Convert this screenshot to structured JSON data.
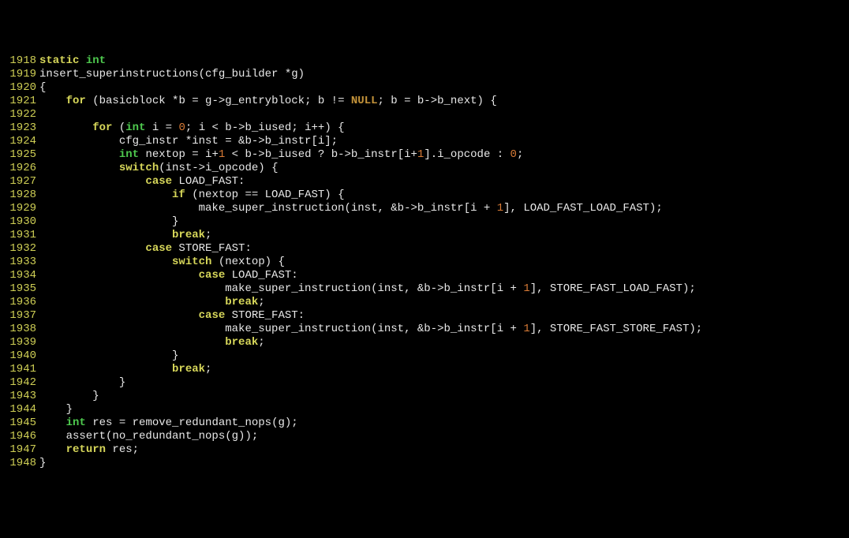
{
  "lines": [
    {
      "n": "1918",
      "segs": [
        {
          "t": "static",
          "c": "kw"
        },
        {
          "t": " "
        },
        {
          "t": "int",
          "c": "type"
        }
      ]
    },
    {
      "n": "1919",
      "segs": [
        {
          "t": "insert_superinstructions(cfg_builder *g)"
        }
      ]
    },
    {
      "n": "1920",
      "segs": [
        {
          "t": "{"
        }
      ]
    },
    {
      "n": "1921",
      "segs": [
        {
          "t": "    "
        },
        {
          "t": "for",
          "c": "kw"
        },
        {
          "t": " (basicblock *b = g->g_entryblock; b != "
        },
        {
          "t": "NULL",
          "c": "null"
        },
        {
          "t": "; b = b->b_next) {"
        }
      ]
    },
    {
      "n": "1922",
      "segs": [
        {
          "t": ""
        }
      ]
    },
    {
      "n": "1923",
      "segs": [
        {
          "t": "        "
        },
        {
          "t": "for",
          "c": "kw"
        },
        {
          "t": " ("
        },
        {
          "t": "int",
          "c": "type"
        },
        {
          "t": " i = "
        },
        {
          "t": "0",
          "c": "num"
        },
        {
          "t": "; i < b->b_iused; i++) {"
        }
      ]
    },
    {
      "n": "1924",
      "segs": [
        {
          "t": "            cfg_instr *inst = &b->b_instr[i];"
        }
      ]
    },
    {
      "n": "1925",
      "segs": [
        {
          "t": "            "
        },
        {
          "t": "int",
          "c": "type"
        },
        {
          "t": " nextop = i+"
        },
        {
          "t": "1",
          "c": "num"
        },
        {
          "t": " < b->b_iused ? b->b_instr[i+"
        },
        {
          "t": "1",
          "c": "num"
        },
        {
          "t": "].i_opcode : "
        },
        {
          "t": "0",
          "c": "num"
        },
        {
          "t": ";"
        }
      ]
    },
    {
      "n": "1926",
      "segs": [
        {
          "t": "            "
        },
        {
          "t": "switch",
          "c": "kw"
        },
        {
          "t": "(inst->i_opcode) {"
        }
      ]
    },
    {
      "n": "1927",
      "segs": [
        {
          "t": "                "
        },
        {
          "t": "case",
          "c": "kw"
        },
        {
          "t": " LOAD_FAST:"
        }
      ]
    },
    {
      "n": "1928",
      "segs": [
        {
          "t": "                    "
        },
        {
          "t": "if",
          "c": "kw"
        },
        {
          "t": " (nextop == LOAD_FAST) {"
        }
      ]
    },
    {
      "n": "1929",
      "segs": [
        {
          "t": "                        make_super_instruction(inst, &b->b_instr[i + "
        },
        {
          "t": "1",
          "c": "num"
        },
        {
          "t": "], LOAD_FAST_LOAD_FAST);"
        }
      ]
    },
    {
      "n": "1930",
      "segs": [
        {
          "t": "                    }"
        }
      ]
    },
    {
      "n": "1931",
      "segs": [
        {
          "t": "                    "
        },
        {
          "t": "break",
          "c": "kw"
        },
        {
          "t": ";"
        }
      ]
    },
    {
      "n": "1932",
      "segs": [
        {
          "t": "                "
        },
        {
          "t": "case",
          "c": "kw"
        },
        {
          "t": " STORE_FAST:"
        }
      ]
    },
    {
      "n": "1933",
      "segs": [
        {
          "t": "                    "
        },
        {
          "t": "switch",
          "c": "kw"
        },
        {
          "t": " (nextop) {"
        }
      ]
    },
    {
      "n": "1934",
      "segs": [
        {
          "t": "                        "
        },
        {
          "t": "case",
          "c": "kw"
        },
        {
          "t": " LOAD_FAST:"
        }
      ]
    },
    {
      "n": "1935",
      "segs": [
        {
          "t": "                            make_super_instruction(inst, &b->b_instr[i + "
        },
        {
          "t": "1",
          "c": "num"
        },
        {
          "t": "], STORE_FAST_LOAD_FAST);"
        }
      ]
    },
    {
      "n": "1936",
      "segs": [
        {
          "t": "                            "
        },
        {
          "t": "break",
          "c": "kw"
        },
        {
          "t": ";"
        }
      ]
    },
    {
      "n": "1937",
      "segs": [
        {
          "t": "                        "
        },
        {
          "t": "case",
          "c": "kw"
        },
        {
          "t": " STORE_FAST:"
        }
      ]
    },
    {
      "n": "1938",
      "segs": [
        {
          "t": "                            make_super_instruction(inst, &b->b_instr[i + "
        },
        {
          "t": "1",
          "c": "num"
        },
        {
          "t": "], STORE_FAST_STORE_FAST);"
        }
      ]
    },
    {
      "n": "1939",
      "segs": [
        {
          "t": "                            "
        },
        {
          "t": "break",
          "c": "kw"
        },
        {
          "t": ";"
        }
      ]
    },
    {
      "n": "1940",
      "segs": [
        {
          "t": "                    }"
        }
      ]
    },
    {
      "n": "1941",
      "segs": [
        {
          "t": "                    "
        },
        {
          "t": "break",
          "c": "kw"
        },
        {
          "t": ";"
        }
      ]
    },
    {
      "n": "1942",
      "segs": [
        {
          "t": "            }"
        }
      ]
    },
    {
      "n": "1943",
      "segs": [
        {
          "t": "        }"
        }
      ]
    },
    {
      "n": "1944",
      "segs": [
        {
          "t": "    }"
        }
      ]
    },
    {
      "n": "1945",
      "segs": [
        {
          "t": "    "
        },
        {
          "t": "int",
          "c": "type"
        },
        {
          "t": " res = remove_redundant_nops(g);"
        }
      ]
    },
    {
      "n": "1946",
      "segs": [
        {
          "t": "    assert(no_redundant_nops(g));"
        }
      ]
    },
    {
      "n": "1947",
      "segs": [
        {
          "t": "    "
        },
        {
          "t": "return",
          "c": "kw"
        },
        {
          "t": " res;"
        }
      ]
    },
    {
      "n": "1948",
      "segs": [
        {
          "t": "}"
        }
      ]
    }
  ]
}
